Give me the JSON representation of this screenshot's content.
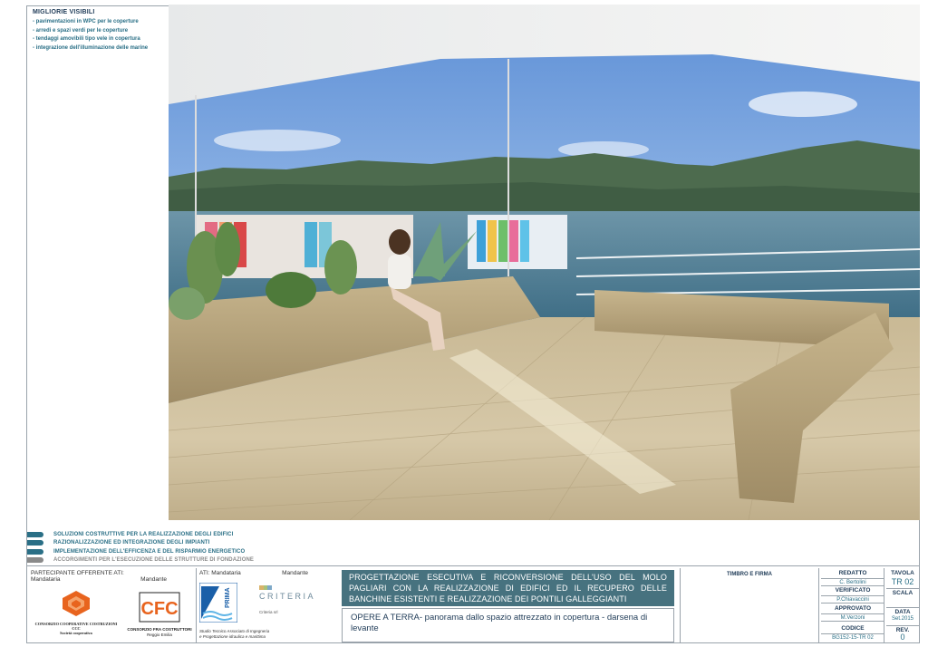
{
  "notes": {
    "title": "MIGLIORIE VISIBILI",
    "items": [
      "- pavimentazioni in WPC per le coperture",
      "- arredi e spazi verdi per le coperture",
      "- tendaggi amovibili tipo vele in copertura",
      "- integrazione dell'illuminazione delle marine"
    ]
  },
  "legend": [
    {
      "text": "SOLUZIONI COSTRUTTIVE PER LA REALIZZAZIONE DEGLI EDIFICI",
      "color": "#2a6f86"
    },
    {
      "text": "RAZIONALIZZAZIONE ED INTEGRAZIONE DEGLI IMPIANTI",
      "color": "#2a6f86"
    },
    {
      "text": "IMPLEMENTAZIONE DELL'EFFICENZA E DEL RISPARMIO ENERGETICO",
      "color": "#2a6f86"
    },
    {
      "text": "ACCORGIMENTI PER L'ESECUZIONE DELLE STRUTTURE DI FONDAZIONE",
      "color": "#8a8a8a"
    }
  ],
  "participants": {
    "heading": "PARTECIPANTE OFFERENTE ATI:",
    "mandataria": "Mandataria",
    "mandante": "Mandante",
    "ccc_caption": [
      "CONSORZIO COOPERATIVE COSTRUZIONI",
      "CCC",
      "Società cooperativa"
    ],
    "cfc_letters": "CFC",
    "cfc_caption": [
      "CONSORZIO FRA COSTRUTTORI",
      "Reggio Emilia"
    ]
  },
  "ati": {
    "heading": "ATI: Mandataria",
    "mandante": "Mandante",
    "prima_word": "PRIMA",
    "prima_caption": [
      "Studio Tecnico Associato di Ingegneria",
      "e Progettazione idraulica e marittima"
    ],
    "criteria_word": "CRITERIA",
    "criteria_srl": "Criteria srl"
  },
  "project": {
    "title": "PROGETTAZIONE ESECUTIVA E RICONVERSIONE DELL'USO DEL MOLO PAGLIARI CON LA REALIZZAZIONE DI EDIFICI ED IL RECUPERO DELLE BANCHINE ESISTENTI E REALIZZAZIONE DEI PONTILI GALLEGGIANTI",
    "subject": "OPERE A TERRA- panorama dallo spazio attrezzato in copertura - darsena di levante"
  },
  "timbro": "TIMBRO E FIRMA",
  "fields": {
    "redatto_label": "REDATTO",
    "redatto_value": "C. Bertolini",
    "verificato_label": "VERIFICATO",
    "verificato_value": "P.Chiavaccini",
    "approvato_label": "APPROVATO",
    "approvato_value": "M.Verzoni",
    "codice_label": "CODICE",
    "codice_value": "BG152-15-TR 02",
    "tavola_label": "TAVOLA",
    "tavola_value": "TR 02",
    "scala_label": "SCALA",
    "data_label": "DATA",
    "data_value": "Set.2015",
    "rev_label": "REV.",
    "rev_value": "0"
  },
  "colors": {
    "accent": "#47727f",
    "text": "#1f3b57",
    "teal": "#2a6f86",
    "ccc_orange": "#e8641e",
    "cfc_orange": "#e8641e",
    "prima_blue": "#1a5fa8"
  }
}
